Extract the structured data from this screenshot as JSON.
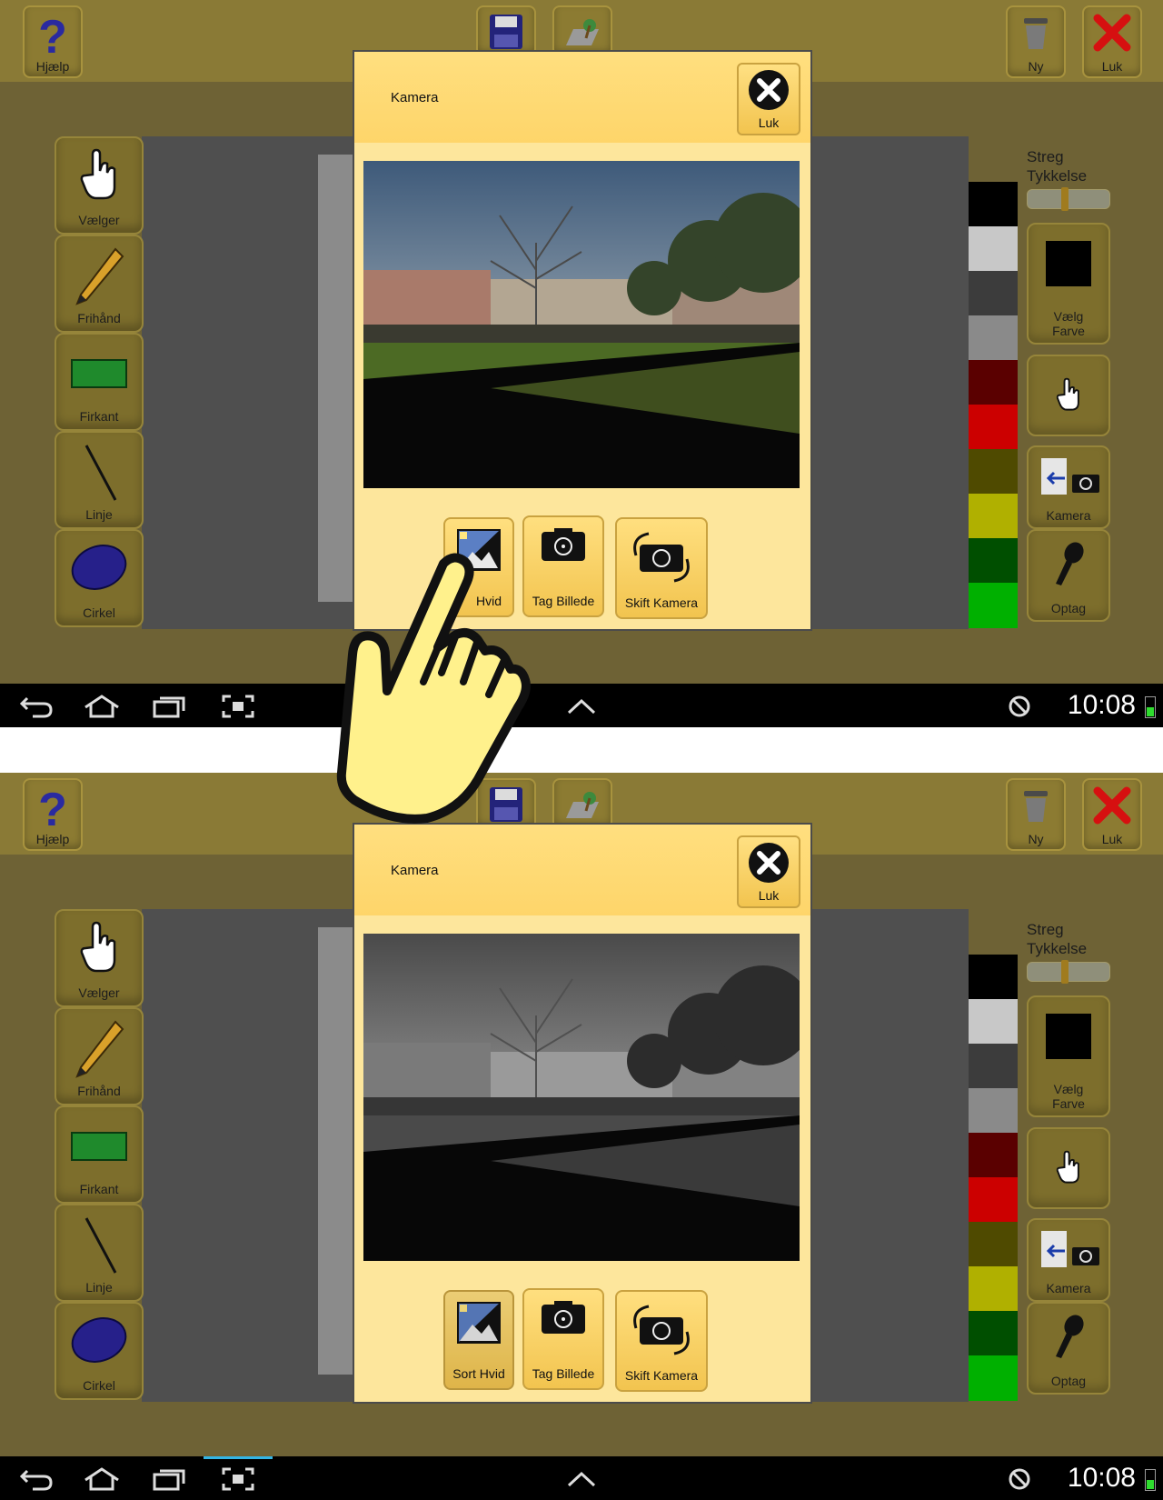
{
  "toolbar": {
    "help_label": "Hjælp",
    "new_label": "Ny",
    "close_label": "Luk"
  },
  "tools": {
    "selector": "Vælger",
    "freehand": "Frihånd",
    "rectangle": "Firkant",
    "line": "Linje",
    "circle": "Cirkel"
  },
  "right_panel": {
    "stroke_line1": "Streg",
    "stroke_line2": "Tykkelse",
    "stroke_value": 0.45,
    "choose_color_line1": "Vælg",
    "choose_color_line2": "Farve",
    "camera_label": "Kamera",
    "record_label": "Optag",
    "selected_color": "#000000",
    "palette": [
      "#000000",
      "#c8c8c8",
      "#3c3c3c",
      "#8a8a8a",
      "#5a0000",
      "#cc0000",
      "#4f4a00",
      "#b0b000",
      "#004f00",
      "#00b000"
    ]
  },
  "dialog": {
    "title": "Kamera",
    "close_label": "Luk",
    "bw_label": "Sort Hvid",
    "bw_label_partial": "Hvid",
    "take_photo_label": "Tag Billede",
    "switch_camera_label": "Skift Kamera"
  },
  "statusbar": {
    "time": "10:08"
  }
}
